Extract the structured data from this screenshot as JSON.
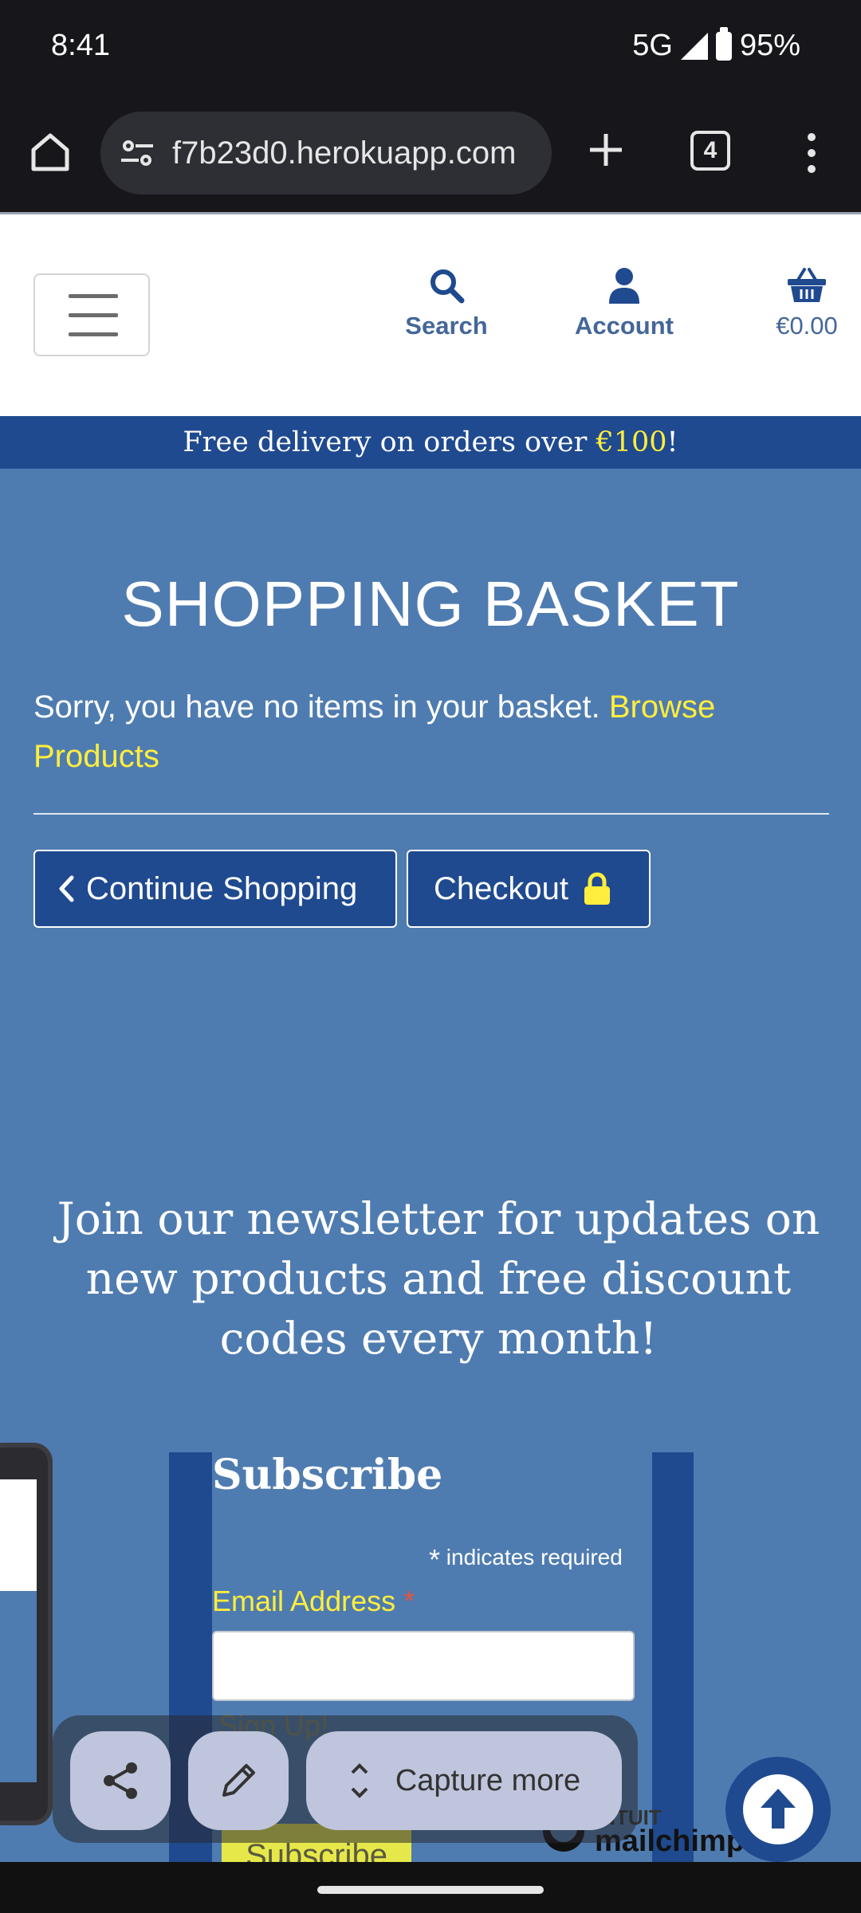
{
  "status_bar": {
    "time": "8:41",
    "network": "5G",
    "battery": "95%"
  },
  "browser": {
    "url": "f7b23d0.herokuapp.com",
    "tab_count": "4"
  },
  "header": {
    "search_label": "Search",
    "account_label": "Account",
    "basket_total": "€0.00"
  },
  "banner": {
    "prefix": "Free delivery on orders over ",
    "amount": "€100",
    "suffix": "!"
  },
  "basket": {
    "title": "SHOPPING BASKET",
    "empty_message": "Sorry, you have no items in your basket. ",
    "browse_link": "Browse Products",
    "continue_label": "Continue Shopping",
    "checkout_label": "Checkout"
  },
  "newsletter": {
    "heading": "Join our newsletter for updates on new products and free discount codes every month!",
    "subscribe_title": "Subscribe",
    "required_note": "indicates required",
    "email_label": "Email Address",
    "signup_text": "Sign Up!",
    "submit_label": "Subscribe",
    "logo_top": "INTUIT",
    "logo_bottom": "mailchimp"
  },
  "capture_toolbar": {
    "capture_more_label": "Capture more"
  },
  "colors": {
    "brand_blue": "#1f4a8f",
    "main_bg": "#4f7cb0",
    "accent_yellow": "#ffee3d"
  }
}
